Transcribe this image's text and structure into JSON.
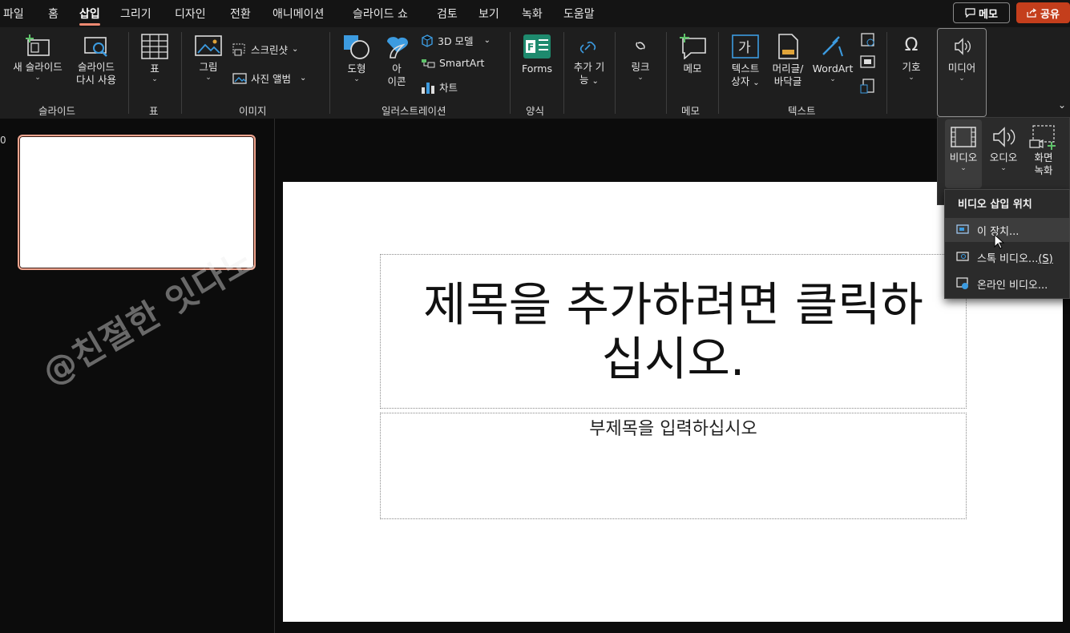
{
  "menu": {
    "tabs": [
      "파일",
      "홈",
      "삽입",
      "그리기",
      "디자인",
      "전환",
      "애니메이션",
      "슬라이드 쇼",
      "검토",
      "보기",
      "녹화",
      "도움말"
    ],
    "active_tab": "삽입",
    "memo_label": "메모",
    "share_label": "공유"
  },
  "ribbon": {
    "slides_group": {
      "new_slide": "새 슬라이드",
      "reuse_slide_1": "슬라이드",
      "reuse_slide_2": "다시 사용",
      "label": "슬라이드"
    },
    "table_group": {
      "table": "표",
      "label": "표"
    },
    "images_group": {
      "picture": "그림",
      "screenshot": "스크린샷",
      "photo_album": "사진 앨범",
      "label": "이미지"
    },
    "illustrations_group": {
      "shapes": "도형",
      "icons_1": "아",
      "icons_2": "이콘",
      "models3d": "3D 모델",
      "smartart": "SmartArt",
      "chart": "차트",
      "label": "일러스트레이션"
    },
    "forms_group": {
      "forms": "Forms",
      "label": "양식"
    },
    "addins": {
      "label_1": "추가 기",
      "label_2": "능"
    },
    "links": {
      "link": "링크"
    },
    "comments_group": {
      "comment": "메모",
      "label": "메모"
    },
    "text_group": {
      "textbox_1": "텍스트",
      "textbox_2": "상자",
      "header_footer_1": "머리글/",
      "header_footer_2": "바닥글",
      "wordart": "WordArt",
      "label": "텍스트"
    },
    "symbols": {
      "symbol": "기호"
    },
    "media": {
      "media": "미디어"
    }
  },
  "thumbnails": {
    "slide_number": "0"
  },
  "slide": {
    "title_line1": "제목을 추가하려면 클릭하",
    "title_line2": "십시오.",
    "subtitle": "부제목을 입력하십시오"
  },
  "watermark": "@친절한 잇다노",
  "media_panel": {
    "video": "비디오",
    "audio": "오디오",
    "screen_rec_1": "화면",
    "screen_rec_2": "녹화"
  },
  "video_menu": {
    "header": "비디오 삽입 위치",
    "items": [
      {
        "label": "이 장치...",
        "shortcut": ""
      },
      {
        "label": "스톡 비디오...",
        "shortcut": "(S)"
      },
      {
        "label": "온라인 비디오...",
        "shortcut": ""
      }
    ]
  },
  "colors": {
    "accent": "#ee8a72",
    "share": "#c43e1c",
    "icon_blue": "#3c9be0",
    "icon_orange": "#e0a43a"
  }
}
